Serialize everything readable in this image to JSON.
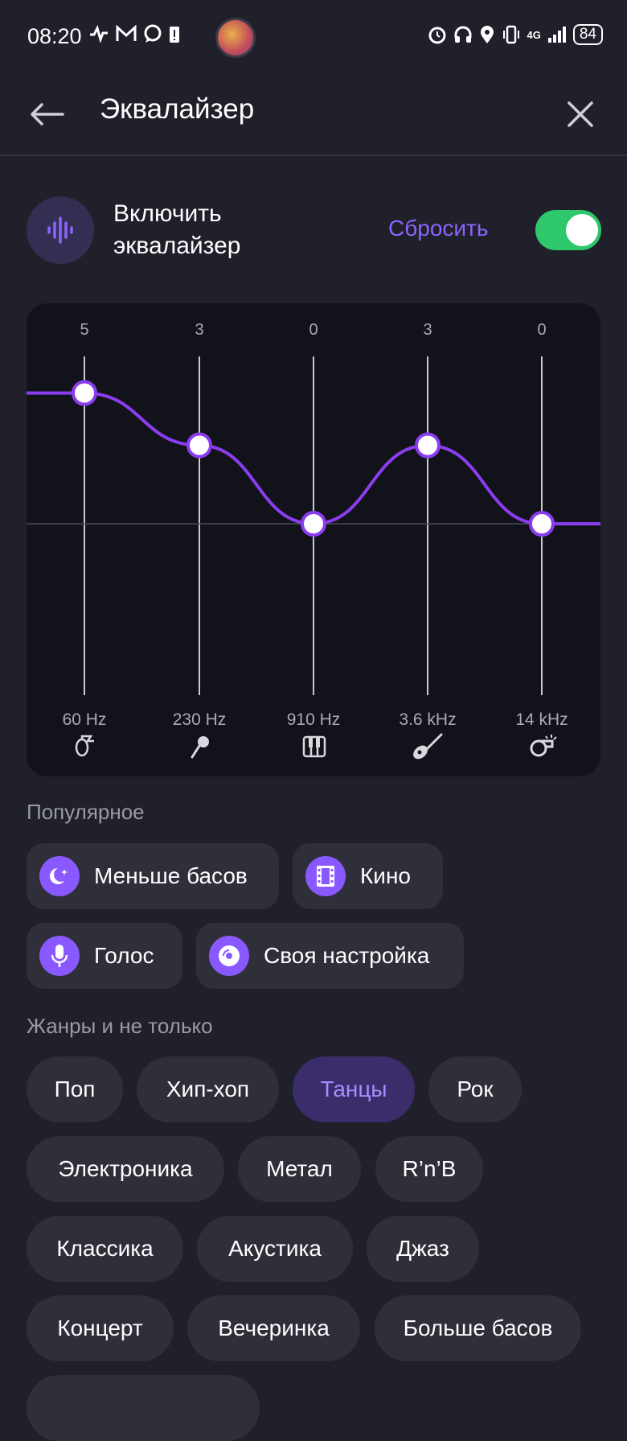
{
  "status_bar": {
    "time": "08:20",
    "battery": "84",
    "network": "4G"
  },
  "header": {
    "title": "Эквалайзер"
  },
  "equalizer_toggle": {
    "label": "Включить эквалайзер",
    "reset_label": "Сбросить",
    "enabled": true
  },
  "equalizer": {
    "bands": [
      {
        "value": "5",
        "freq": "60 Hz",
        "icon": "tuba-icon"
      },
      {
        "value": "3",
        "freq": "230 Hz",
        "icon": "microphone-icon"
      },
      {
        "value": "0",
        "freq": "910 Hz",
        "icon": "piano-icon"
      },
      {
        "value": "3",
        "freq": "3.6 kHz",
        "icon": "guitar-icon"
      },
      {
        "value": "0",
        "freq": "14 kHz",
        "icon": "whistle-icon"
      }
    ],
    "accent_color": "#8b3cf0"
  },
  "popular": {
    "title": "Популярное",
    "items": [
      {
        "label": "Меньше басов",
        "icon": "moon-icon"
      },
      {
        "label": "Кино",
        "icon": "film-icon"
      },
      {
        "label": "Голос",
        "icon": "microphone-icon"
      },
      {
        "label": "Своя настройка",
        "icon": "disc-icon"
      }
    ]
  },
  "genres": {
    "title": "Жанры и не только",
    "items": [
      "Поп",
      "Хип-хоп",
      "Танцы",
      "Рок",
      "Электроника",
      "Метал",
      "R’n’B",
      "Классика",
      "Акустика",
      "Джаз",
      "Концерт",
      "Вечеринка",
      "Больше басов"
    ],
    "active": "Танцы"
  },
  "colors": {
    "background": "#1f2029",
    "accent": "#8d63ff",
    "toggle_on": "#2fc76c"
  }
}
